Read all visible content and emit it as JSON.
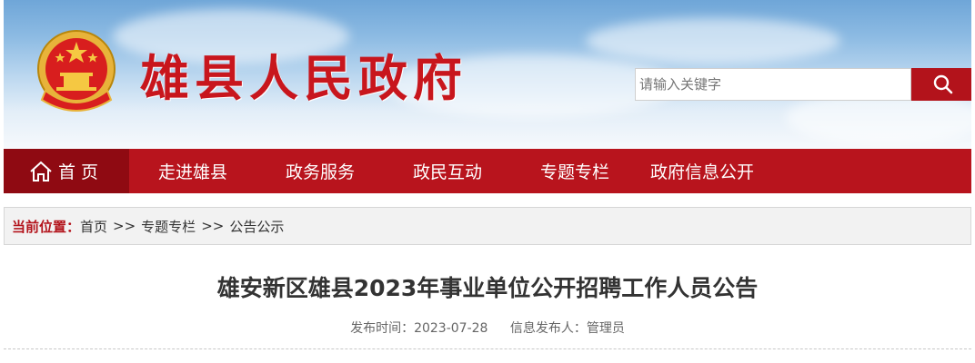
{
  "header": {
    "site_title": "雄县人民政府",
    "search": {
      "placeholder": "请输入关键字"
    },
    "search_button_icon": "search-icon",
    "emblem_icon": "national-emblem-icon"
  },
  "nav": {
    "items": [
      {
        "label": "首页",
        "icon": "home-icon"
      },
      {
        "label": "走进雄县"
      },
      {
        "label": "政务服务"
      },
      {
        "label": "政民互动"
      },
      {
        "label": "专题专栏"
      },
      {
        "label": "政府信息公开"
      }
    ]
  },
  "breadcrumb": {
    "label": "当前位置：",
    "items": [
      "首页",
      "专题专栏",
      "公告公示"
    ],
    "separator": ">>"
  },
  "article": {
    "title": "雄安新区雄县2023年事业单位公开招聘工作人员公告",
    "published": "发布时间：2023-07-28",
    "publisher": "信息发布人：管理员"
  },
  "colors": {
    "brand_red": "#b8141d",
    "nav_active": "#8f0a12",
    "title_red": "#c8161d"
  }
}
